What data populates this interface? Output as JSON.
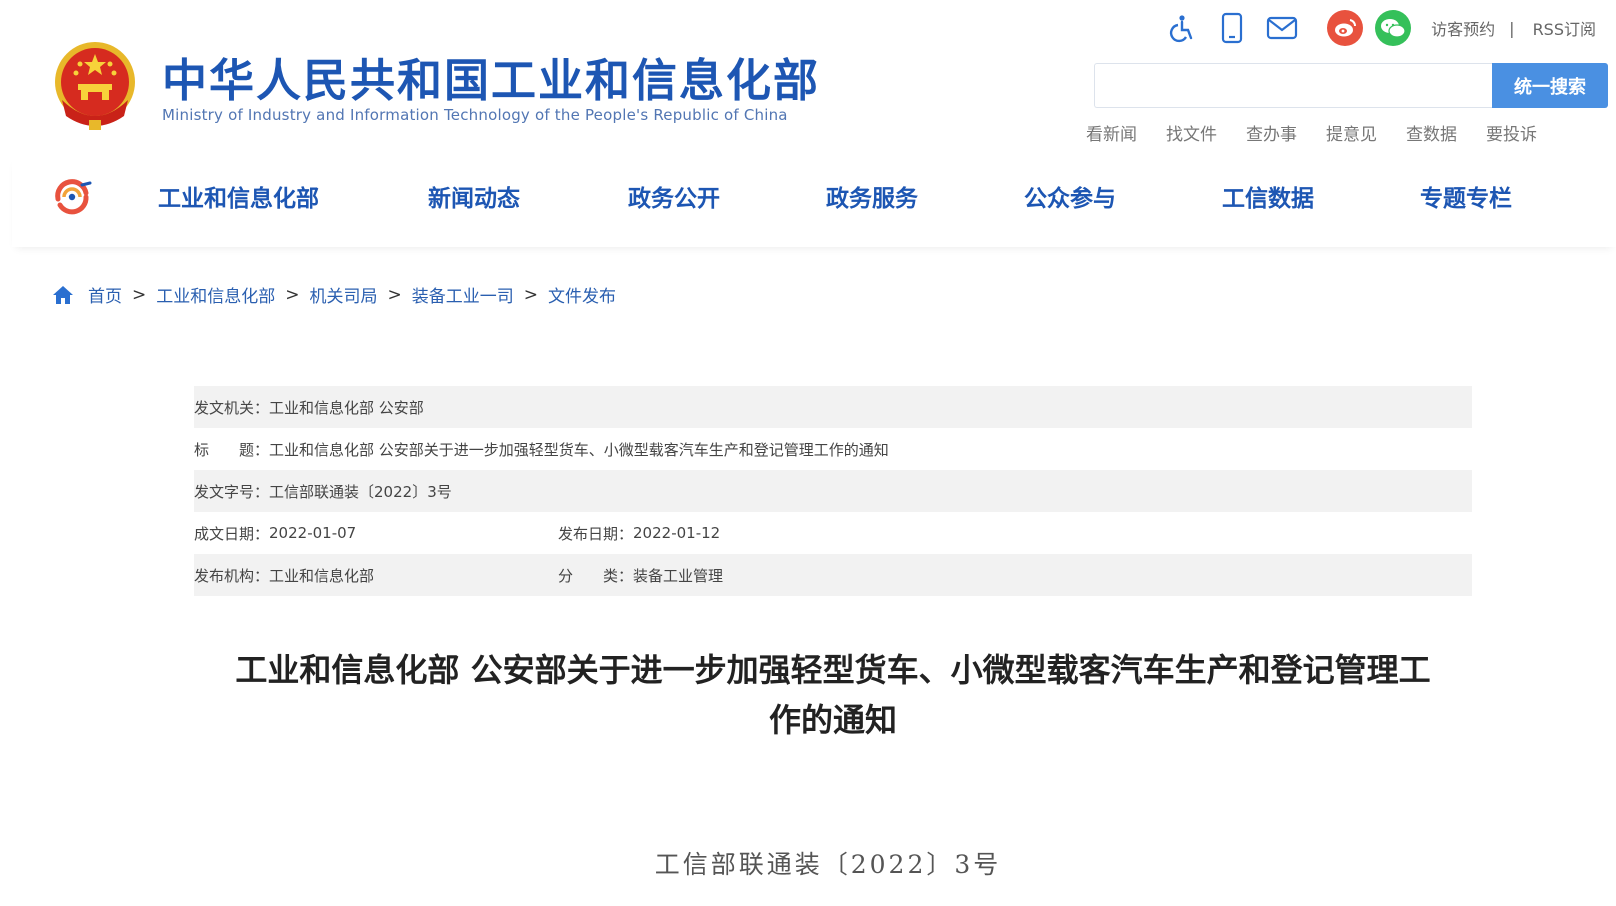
{
  "header": {
    "title": "中华人民共和国工业和信息化部",
    "subtitle": "Ministry of Industry and Information Technology of the People's Republic of China"
  },
  "utility": {
    "icons": [
      "accessibility-icon",
      "mobile-phone-icon",
      "mail-icon",
      "weibo-icon",
      "wechat-icon"
    ],
    "visitor_booking": "访客预约",
    "separator": "|",
    "rss": "RSS订阅"
  },
  "search": {
    "placeholder": "",
    "button_label": "统一搜索"
  },
  "quick_links": [
    "看新闻",
    "找文件",
    "查办事",
    "提意见",
    "查数据",
    "要投诉"
  ],
  "nav": {
    "items": [
      "工业和信息化部",
      "新闻动态",
      "政务公开",
      "政务服务",
      "公众参与",
      "工信数据",
      "专题专栏"
    ]
  },
  "breadcrumb": {
    "items": [
      "首页",
      "工业和信息化部",
      "机关司局",
      "装备工业一司",
      "文件发布"
    ],
    "separator": ">"
  },
  "meta": {
    "issuer_label": "发文机关：",
    "issuer": "工业和信息化部 公安部",
    "title_label": "标　　题：",
    "title": "工业和信息化部 公安部关于进一步加强轻型货车、小微型载客汽车生产和登记管理工作的通知",
    "doc_no_label": "发文字号：",
    "doc_no": "工信部联通装〔2022〕3号",
    "written_date_label": "成文日期：",
    "written_date": "2022-01-07",
    "publish_date_label": "发布日期：",
    "publish_date": "2022-01-12",
    "publisher_label": "发布机构：",
    "publisher": "工业和信息化部",
    "category_label": "分　　类：",
    "category": "装备工业管理"
  },
  "article": {
    "title_line1": "工业和信息化部 公安部关于进一步加强轻型货车、小微型载客汽车生产和登记管理工",
    "title_line2": "作的通知",
    "doc_number": "工信部联通装〔2022〕3号"
  },
  "colors": {
    "brand_blue": "#1d56b3",
    "search_button": "#4a90e2",
    "emblem_red": "#d62b1f",
    "emblem_gold": "#f2c12e"
  }
}
